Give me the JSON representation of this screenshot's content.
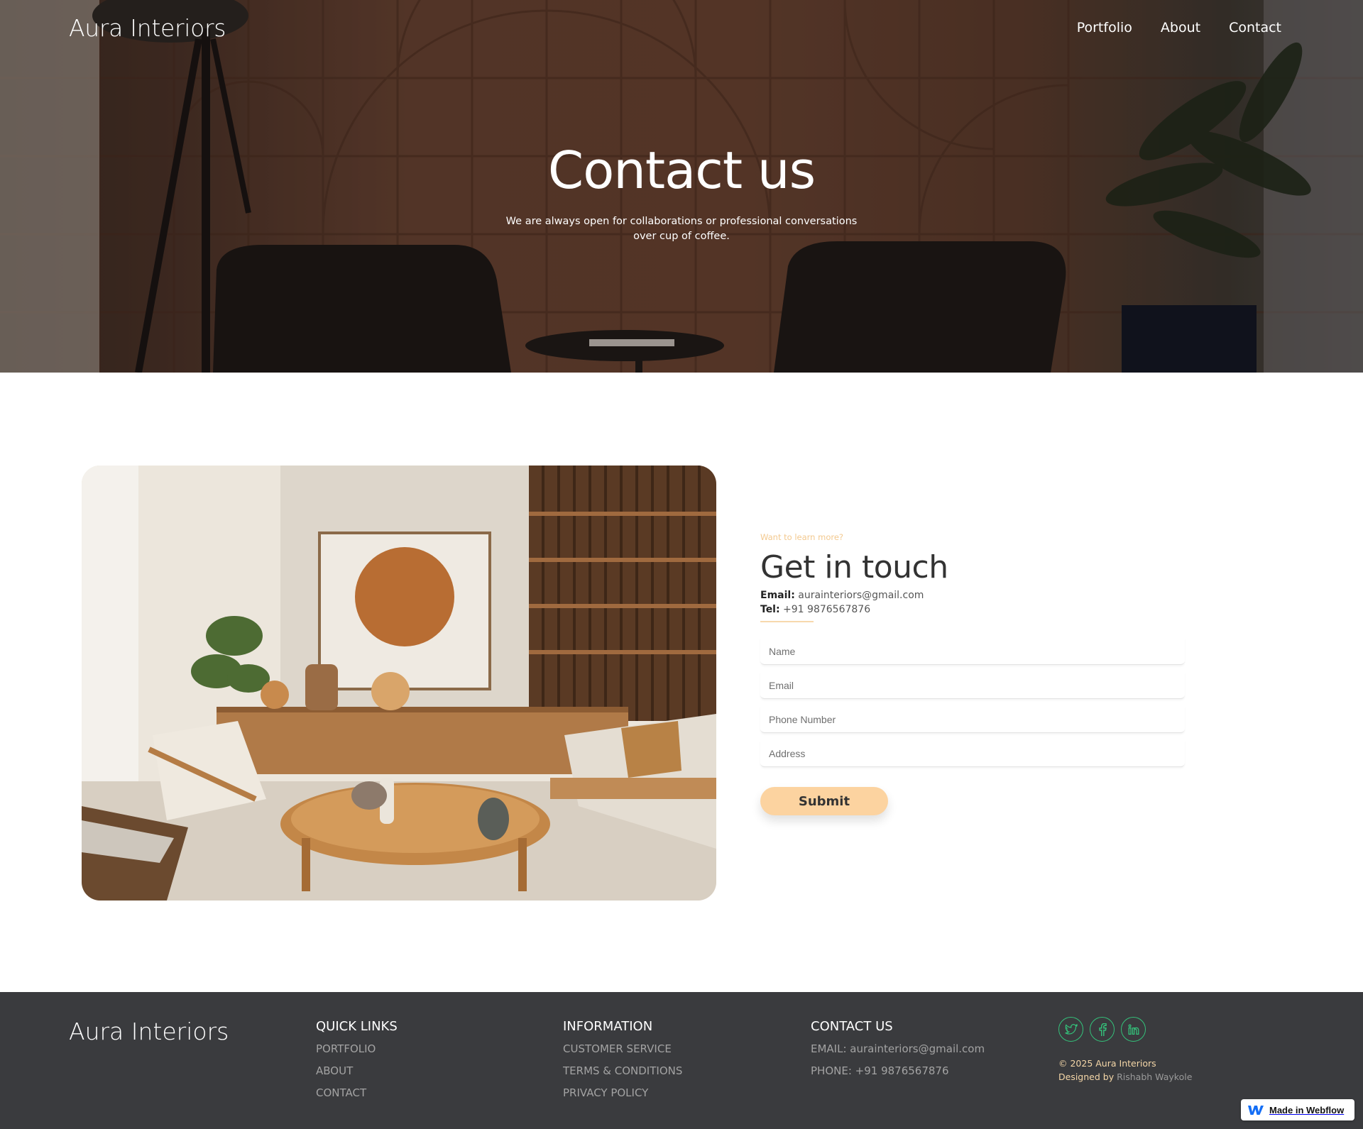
{
  "header": {
    "brand": "Aura Interiors",
    "nav": [
      "Portfolio",
      "About",
      "Contact"
    ]
  },
  "hero": {
    "title": "Contact us",
    "subtitle": "We are always open for collaborations or professional conversations over cup of coffee."
  },
  "contact": {
    "eyebrow": "Want to learn more?",
    "title": "Get in touch",
    "email_label": "Email:",
    "email": "aurainteriors@gmail.com",
    "tel_label": "Tel:",
    "tel": "+91 9876567876",
    "form": {
      "name_placeholder": "Name",
      "email_placeholder": "Email",
      "phone_placeholder": "Phone Number",
      "address_placeholder": "Address",
      "submit_label": "Submit"
    }
  },
  "footer": {
    "brand": "Aura Interiors",
    "quick_links": {
      "heading": "QUICK LINKS",
      "items": [
        "PORTFOLIO",
        "ABOUT",
        "CONTACT"
      ]
    },
    "information": {
      "heading": "INFORMATION",
      "items": [
        "CUSTOMER SERVICE",
        "TERMS & CONDITIONS",
        "PRIVACY POLICY"
      ]
    },
    "contact_us": {
      "heading": "CONTACT US",
      "items": [
        "EMAIL: aurainteriors@gmail.com",
        "PHONE: +91 9876567876"
      ]
    },
    "socials": [
      "twitter-icon",
      "facebook-icon",
      "linkedin-icon"
    ],
    "copyright": "© 2025 Aura Interiors",
    "designed_by_label": "Designed by",
    "designer": "Rishabh Waykole"
  },
  "badge": {
    "label": "Made in Webflow"
  },
  "colors": {
    "accent": "#fcd3a0",
    "footer_bg": "#3a3b3e",
    "social_green": "#34c17a"
  }
}
